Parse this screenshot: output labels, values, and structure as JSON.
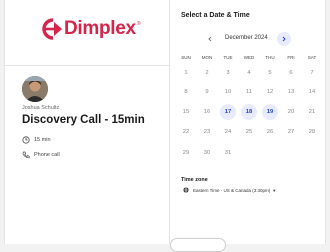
{
  "brand": {
    "name": "Dimplex",
    "reg": "®",
    "color": "#d6244a"
  },
  "event": {
    "host": "Joshua Schultz",
    "title": "Discovery Call - 15min",
    "duration": "15 min",
    "location": "Phone call"
  },
  "calendar": {
    "heading": "Select a Date & Time",
    "month": "December 2024",
    "weekdays": [
      "SUN",
      "MON",
      "TUE",
      "WED",
      "THU",
      "FRI",
      "SAT"
    ],
    "weeks": [
      [
        "1",
        "2",
        "3",
        "4",
        "5",
        "6",
        "7"
      ],
      [
        "8",
        "9",
        "10",
        "11",
        "12",
        "13",
        "14"
      ],
      [
        "15",
        "16",
        "17",
        "18",
        "19",
        "20",
        "21"
      ],
      [
        "22",
        "23",
        "24",
        "25",
        "26",
        "27",
        "28"
      ],
      [
        "29",
        "30",
        "31",
        "",
        "",
        "",
        ""
      ]
    ],
    "available": [
      "17",
      "18",
      "19"
    ],
    "accent": "#1f3fd8",
    "accent_bg": "#e8ebff"
  },
  "timezone": {
    "label": "Time zone",
    "value": "Eastern Time - US & Canada (3:30pm)"
  }
}
